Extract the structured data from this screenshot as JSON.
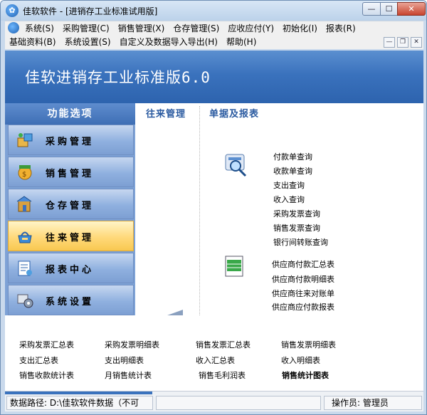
{
  "window": {
    "title": "佳软软件 - [进销存工业标准试用版]",
    "buttons": {
      "minimize": "—",
      "maximize": "☐",
      "close": "✕"
    }
  },
  "menu": {
    "row1": [
      "系统(S)",
      "采购管理(C)",
      "销售管理(X)",
      "仓存管理(S)",
      "应收应付(Y)",
      "初始化(I)",
      "报表(R)"
    ],
    "row2": [
      "基础资料(B)",
      "系统设置(S)",
      "自定义及数据导入导出(H)",
      "帮助(H)"
    ],
    "mdi": {
      "minimize": "—",
      "restore": "❐",
      "close": "✕"
    }
  },
  "banner": {
    "title": "佳软进销存工业标准版6.0"
  },
  "sidebar": {
    "header": "功能选项",
    "items": [
      {
        "label": "采购管理",
        "icon": "purchase-icon"
      },
      {
        "label": "销售管理",
        "icon": "sales-icon"
      },
      {
        "label": "仓存管理",
        "icon": "warehouse-icon"
      },
      {
        "label": "往来管理",
        "icon": "accounts-icon"
      },
      {
        "label": "报表中心",
        "icon": "report-icon"
      },
      {
        "label": "系统设置",
        "icon": "settings-icon"
      }
    ],
    "active_index": 3
  },
  "columns": {
    "left": "往来管理",
    "right": "单据及报表"
  },
  "query_links": [
    "付款单查询",
    "收款单查询",
    "支出查询",
    "收入查询",
    "采购发票查询",
    "销售发票查询",
    "银行间转账查询"
  ],
  "supplier_links": [
    "供应商付款汇总表",
    "供应商付款明细表",
    "供应商往来对账单",
    "供应商应付款报表"
  ],
  "bottom_links": [
    [
      "采购发票汇总表",
      "采购发票明细表",
      "销售发票汇总表",
      "销售发票明细表"
    ],
    [
      "支出汇总表",
      "支出明细表",
      "收入汇总表",
      "收入明细表"
    ],
    [
      "销售收款统计表",
      "月销售统计表",
      "销售毛利润表",
      "销售统计图表"
    ]
  ],
  "status": {
    "path": "数据路径: D:\\佳软软件数据（不可",
    "operator": "操作员: 管理员"
  },
  "colors": {
    "banner": "#3a72bd",
    "active_item": "#ffd97a",
    "sidebar": "#7ea2d6"
  }
}
